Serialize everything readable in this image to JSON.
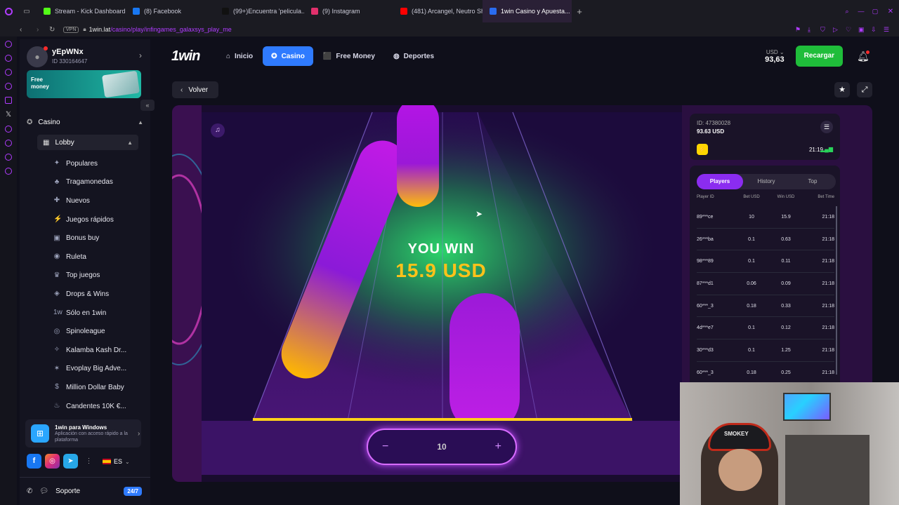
{
  "browser": {
    "tabs": [
      {
        "label": "Stream - Kick Dashboard",
        "color": "#53fc18"
      },
      {
        "label": "(8) Facebook",
        "color": "#1877f2"
      },
      {
        "label": "(99+)Encuentra 'pelicula...",
        "color": "#111111"
      },
      {
        "label": "(9) Instagram",
        "color": "#e1306c"
      },
      {
        "label": "(481) Arcangel, Neutro Sh...",
        "color": "#ff0000"
      },
      {
        "label": "1win Casino y Apuesta...",
        "color": "#2a6cf0"
      }
    ],
    "vpn_label": "VPN",
    "url_host": "1win.lat",
    "url_path": "/casino/play/infingames_galaxsys_play_me"
  },
  "user": {
    "name": "yEpWNx",
    "id_label": "ID 330164647"
  },
  "promo": {
    "label": "Free money",
    "colors": {
      "start": "#0d8a8a",
      "end": "#1fb8a4"
    }
  },
  "sidebar": {
    "section_label": "Casino",
    "lobby_label": "Lobby",
    "items": [
      {
        "label": "Populares",
        "icon": "star-icon"
      },
      {
        "label": "Tragamonedas",
        "icon": "cherry-icon"
      },
      {
        "label": "Nuevos",
        "icon": "new-icon"
      },
      {
        "label": "Juegos rápidos",
        "icon": "bolt-icon"
      },
      {
        "label": "Bonus buy",
        "icon": "cart-icon"
      },
      {
        "label": "Ruleta",
        "icon": "roulette-icon"
      },
      {
        "label": "Top juegos",
        "icon": "trophy-icon"
      },
      {
        "label": "Drops & Wins",
        "icon": "drops-icon"
      },
      {
        "label": "Sólo en 1win",
        "icon": "1win-icon"
      },
      {
        "label": "Spinoleague",
        "icon": "league-icon"
      },
      {
        "label": "Kalamba Kash Dr...",
        "icon": "kalamba-icon"
      },
      {
        "label": "Evoplay Big Adve...",
        "icon": "evoplay-icon"
      },
      {
        "label": "Million Dollar Baby",
        "icon": "dollar-icon"
      },
      {
        "label": "Candentes 10K €...",
        "icon": "fire-icon"
      }
    ],
    "app_title": "1win para Windows",
    "app_desc": "Aplicación con acceso rápido a la plataforma",
    "lang": "ES",
    "support_label": "Soporte",
    "support_badge": "24/7"
  },
  "header": {
    "logo": "1win",
    "nav": [
      {
        "label": "Inicio",
        "icon": "home-icon",
        "active": false
      },
      {
        "label": "Casino",
        "icon": "casino-chip-icon",
        "active": true
      },
      {
        "label": "Free Money",
        "icon": "gift-icon",
        "active": false
      },
      {
        "label": "Deportes",
        "icon": "ball-icon",
        "active": false
      }
    ],
    "currency": "USD",
    "balance": "93,63",
    "deposit_label": "Recargar",
    "colors": {
      "accent": "#2f7bff",
      "deposit": "#1fbd3a"
    }
  },
  "game_bar": {
    "back_label": "Volver"
  },
  "game": {
    "win_title": "YOU WIN",
    "win_amount": "15.9",
    "win_currency": "USD",
    "bet_value": "10",
    "minus": "−",
    "plus": "+"
  },
  "panel": {
    "id_label": "ID: 47380028",
    "balance_label": "93.63 USD",
    "time": "21:19",
    "tabs": [
      "Players",
      "History",
      "Top"
    ],
    "active_tab": "Players",
    "columns": [
      "Player ID",
      "Bet USD",
      "Win USD",
      "Bet Time"
    ],
    "rows": [
      {
        "player": "89***ce",
        "bet": "10",
        "win": "15.9",
        "time": "21:18"
      },
      {
        "player": "26***ba",
        "bet": "0.1",
        "win": "0.63",
        "time": "21:18"
      },
      {
        "player": "98***89",
        "bet": "0.1",
        "win": "0.11",
        "time": "21:18"
      },
      {
        "player": "87***d1",
        "bet": "0.06",
        "win": "0.09",
        "time": "21:18"
      },
      {
        "player": "60***_3",
        "bet": "0.18",
        "win": "0.33",
        "time": "21:18"
      },
      {
        "player": "4d***e7",
        "bet": "0.1",
        "win": "0.12",
        "time": "21:18"
      },
      {
        "player": "30***d3",
        "bet": "0.1",
        "win": "1.25",
        "time": "21:18"
      },
      {
        "player": "60***_3",
        "bet": "0.18",
        "win": "0.25",
        "time": "21:18"
      }
    ]
  },
  "webcam": {
    "cap_logo": "SMOKEY"
  }
}
